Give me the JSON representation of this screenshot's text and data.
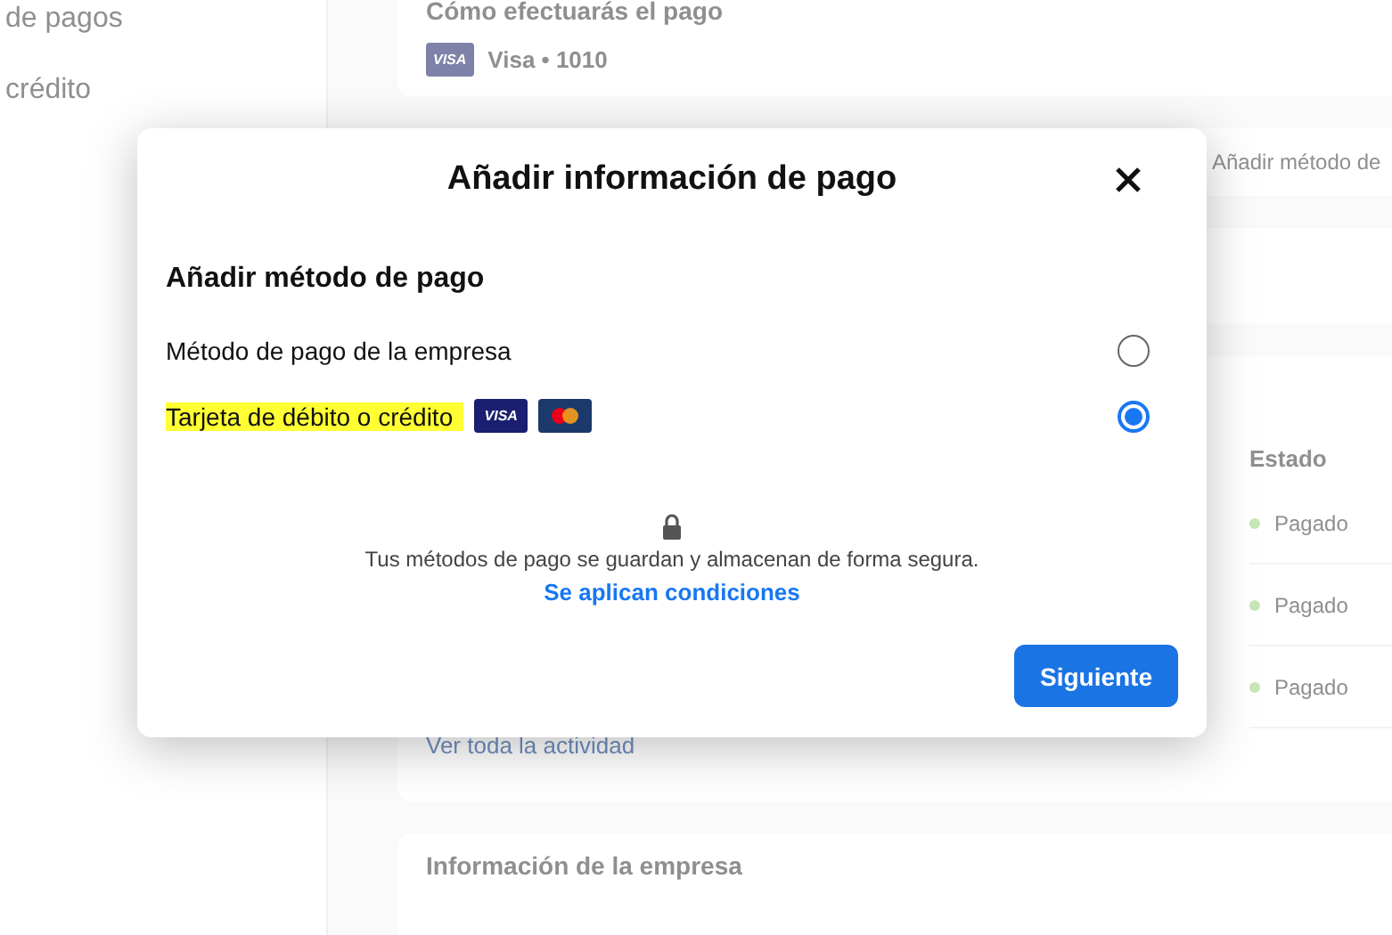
{
  "sidebar": {
    "items": [
      {
        "label": "de pagos"
      },
      {
        "label": "crédito"
      }
    ]
  },
  "payment_card": {
    "title": "Cómo efectuarás el pago",
    "card_brand": "VISA",
    "card_label": "Visa • 1010"
  },
  "methods_card": {
    "add_button": "Añadir método de"
  },
  "activity": {
    "status_header": "Estado",
    "rows": [
      {
        "status": "Pagado",
        "color": "#c8e6b8"
      },
      {
        "status": "Pagado",
        "color": "#c8e6b8"
      },
      {
        "status": "Pagado",
        "color": "#c8e6b8"
      }
    ],
    "link": "Ver toda la actividad"
  },
  "company_card": {
    "title": "Información de la empresa"
  },
  "dialog": {
    "title": "Añadir información de pago",
    "section_title": "Añadir método de pago",
    "options": [
      {
        "label": "Método de pago de la empresa",
        "selected": false,
        "highlighted": false,
        "kind": "plain"
      },
      {
        "label": "Tarjeta de débito o crédito",
        "selected": true,
        "highlighted": true,
        "kind": "card",
        "brands": [
          "VISA"
        ]
      }
    ],
    "security_note": "Tus métodos de pago se guardan y almacenan de forma segura.",
    "terms_link": "Se aplican condiciones",
    "next_button": "Siguiente"
  }
}
